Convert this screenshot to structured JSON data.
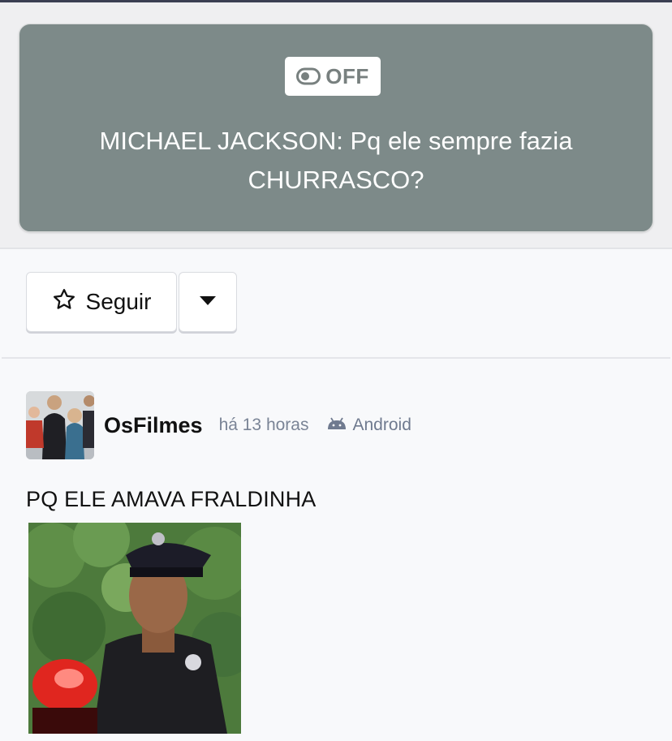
{
  "topic": {
    "badge_label": "OFF",
    "title": "MICHAEL JACKSON: Pq ele sempre fazia CHURRASCO?"
  },
  "actions": {
    "follow_label": "Seguir",
    "follow_icon": "star-outline-icon",
    "menu_icon": "caret-down-icon"
  },
  "post": {
    "author": "OsFilmes",
    "time": "há 13 horas",
    "platform": "Android",
    "platform_icon": "android-icon",
    "text": "PQ ELE AMAVA FRALDINHA"
  },
  "colors": {
    "card": "#7d8a89",
    "badge_text": "#78807f",
    "meta": "#7a8496"
  }
}
